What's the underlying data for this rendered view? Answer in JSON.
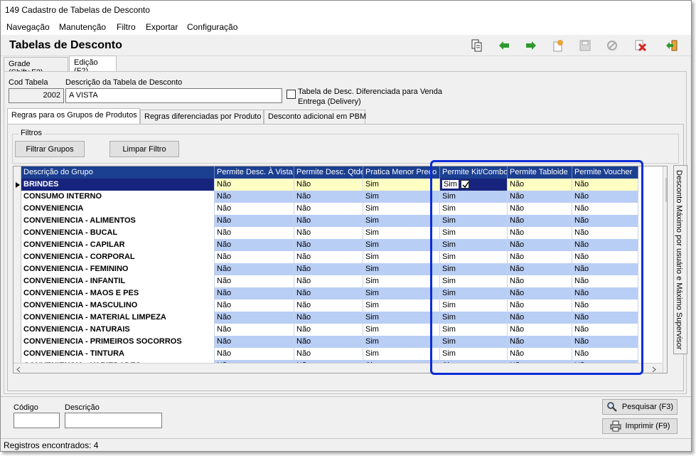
{
  "window": {
    "title": "149 Cadastro de Tabelas de Desconto"
  },
  "menu": {
    "items": [
      {
        "label": "Navegação"
      },
      {
        "label": "Manutenção"
      },
      {
        "label": "Filtro"
      },
      {
        "label": "Exportar"
      },
      {
        "label": "Configuração"
      }
    ]
  },
  "header": {
    "title": "Tabelas de Desconto"
  },
  "toolbar": {
    "icons": [
      "copy-icon",
      "arrow-left-icon",
      "arrow-right-icon",
      "new-icon",
      "save-icon",
      "cancel-icon",
      "delete-icon",
      "exit-icon"
    ],
    "colors": {
      "green": "#2e9a2e",
      "red": "#d8241c",
      "orange": "#e8a33a"
    }
  },
  "main_tabs": [
    {
      "label": "Grade (Shift+F3)"
    },
    {
      "label": "Edição (F2)"
    }
  ],
  "form": {
    "cod_label": "Cod Tabela",
    "cod_value": "2002",
    "desc_label": "Descrição da Tabela de Desconto",
    "desc_value": "A VISTA",
    "checkbox_label_line1": "Tabela de Desc. Diferenciada para Venda",
    "checkbox_label_line2": "Entrega (Delivery)"
  },
  "sub_tabs": [
    {
      "label": "Regras para os Grupos de Produtos"
    },
    {
      "label": "Regras diferenciadas por Produto"
    },
    {
      "label": "Desconto adicional em PBM"
    }
  ],
  "filters": {
    "legend": "Filtros",
    "filter_button": "Filtrar Grupos",
    "clear_button": "Limpar Filtro"
  },
  "grid": {
    "headers": [
      "Descrição do Grupo",
      "Permite Desc. À Vista",
      "Permite Desc. Qtde",
      "Pratica Menor Preço",
      "Permite Kit/Combo",
      "Permite Tabloide",
      "Permite Voucher"
    ],
    "rows": [
      [
        "BRINDES",
        "Não",
        "Não",
        "Sim",
        "Sim",
        "Não",
        "Não"
      ],
      [
        "CONSUMO INTERNO",
        "Não",
        "Não",
        "Sim",
        "Sim",
        "Não",
        "Não"
      ],
      [
        "CONVENIENCIA",
        "Não",
        "Não",
        "Sim",
        "Sim",
        "Não",
        "Não"
      ],
      [
        "CONVENIENCIA - ALIMENTOS",
        "Não",
        "Não",
        "Sim",
        "Sim",
        "Não",
        "Não"
      ],
      [
        "CONVENIENCIA - BUCAL",
        "Não",
        "Não",
        "Sim",
        "Sim",
        "Não",
        "Não"
      ],
      [
        "CONVENIENCIA - CAPILAR",
        "Não",
        "Não",
        "Sim",
        "Sim",
        "Não",
        "Não"
      ],
      [
        "CONVENIENCIA - CORPORAL",
        "Não",
        "Não",
        "Sim",
        "Sim",
        "Não",
        "Não"
      ],
      [
        "CONVENIENCIA - FEMININO",
        "Não",
        "Não",
        "Sim",
        "Sim",
        "Não",
        "Não"
      ],
      [
        "CONVENIENCIA - INFANTIL",
        "Não",
        "Não",
        "Sim",
        "Sim",
        "Não",
        "Não"
      ],
      [
        "CONVENIENCIA - MAOS E PES",
        "Não",
        "Não",
        "Sim",
        "Sim",
        "Não",
        "Não"
      ],
      [
        "CONVENIENCIA - MASCULINO",
        "Não",
        "Não",
        "Sim",
        "Sim",
        "Não",
        "Não"
      ],
      [
        "CONVENIENCIA - MATERIAL LIMPEZA",
        "Não",
        "Não",
        "Sim",
        "Sim",
        "Não",
        "Não"
      ],
      [
        "CONVENIENCIA - NATURAIS",
        "Não",
        "Não",
        "Sim",
        "Sim",
        "Não",
        "Não"
      ],
      [
        "CONVENIENCIA - PRIMEIROS SOCORROS",
        "Não",
        "Não",
        "Sim",
        "Sim",
        "Não",
        "Não"
      ],
      [
        "CONVENIENCIA - TINTURA",
        "Não",
        "Não",
        "Sim",
        "Sim",
        "Não",
        "Não"
      ],
      [
        "CONVENIENCIA - VARIEDADES",
        "Não",
        "Não",
        "Sim",
        "Sim",
        "Não",
        "Não"
      ]
    ],
    "header_color": "#1b3f91",
    "alt_row_color": "#b9cef4",
    "selected_row_color": "#ffffc4"
  },
  "side_panel": {
    "label": "Desconto Máximo por usuário e Máximo Supervisor"
  },
  "search_area": {
    "codigo_label": "Código",
    "descricao_label": "Descrição",
    "pesquisar_button": "Pesquisar (F3)",
    "imprimir_button": "Imprimir (F9)"
  },
  "status": {
    "text": "Registros encontrados: 4"
  }
}
